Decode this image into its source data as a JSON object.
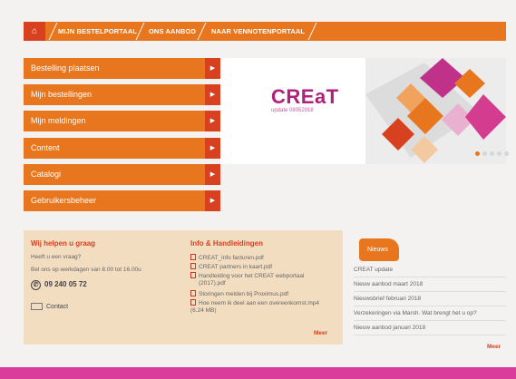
{
  "nav": {
    "home_icon": "home-icon",
    "links": [
      "MIJN BESTELPORTAAL",
      "ONS AANBOD",
      "NAAR VENNOTENPORTAAL"
    ]
  },
  "menu": {
    "items": [
      {
        "label": "Bestelling plaatsen"
      },
      {
        "label": "Mijn bestellingen"
      },
      {
        "label": "Mijn meldingen"
      },
      {
        "label": "Content"
      },
      {
        "label": "Catalogi"
      },
      {
        "label": "Gebruikersbeheer"
      }
    ],
    "arrow": "▶"
  },
  "banner": {
    "logo": "CREaT",
    "subtitle": "update 08052018",
    "slide_count": 5,
    "active_slide": 1
  },
  "help": {
    "title": "Wij helpen u graag",
    "question": "Heeft u een vraag?",
    "hours": "Bel ons op werkdagen van 8.00 tot 16.00u",
    "phone": "09 240 05 72",
    "contact": "Contact"
  },
  "info": {
    "title": "Info & Handleidingen",
    "docs": [
      {
        "lines": [
          "CREAT_info facturen.pdf"
        ]
      },
      {
        "lines": [
          "CREAT partners in kaart.pdf"
        ]
      },
      {
        "lines": [
          "Handleiding voor het CREAT webportaal",
          "(2017).pdf"
        ]
      },
      {
        "lines": [
          "Storingen melden bij Proximus.pdf"
        ]
      },
      {
        "lines": [
          "Hoe neem ik deel aan een overeenkomst.mp4",
          "(6.24 MB)"
        ]
      }
    ],
    "more": "Meer"
  },
  "news": {
    "tab": "Nieuws",
    "items": [
      "CREAT update",
      "Nieuw aanbod maart 2018",
      "Nieuwsbrief februari 2018",
      "Verzekeringen via Marsh. Wat brengt het u op?",
      "Nieuw aanbod januari 2018"
    ],
    "more": "Meer"
  },
  "colors": {
    "accent": "#e8761e",
    "accent_dark": "#d8411f",
    "brand": "#b0217c",
    "footer": "#d93d9b",
    "panel": "#f3ddc1"
  }
}
